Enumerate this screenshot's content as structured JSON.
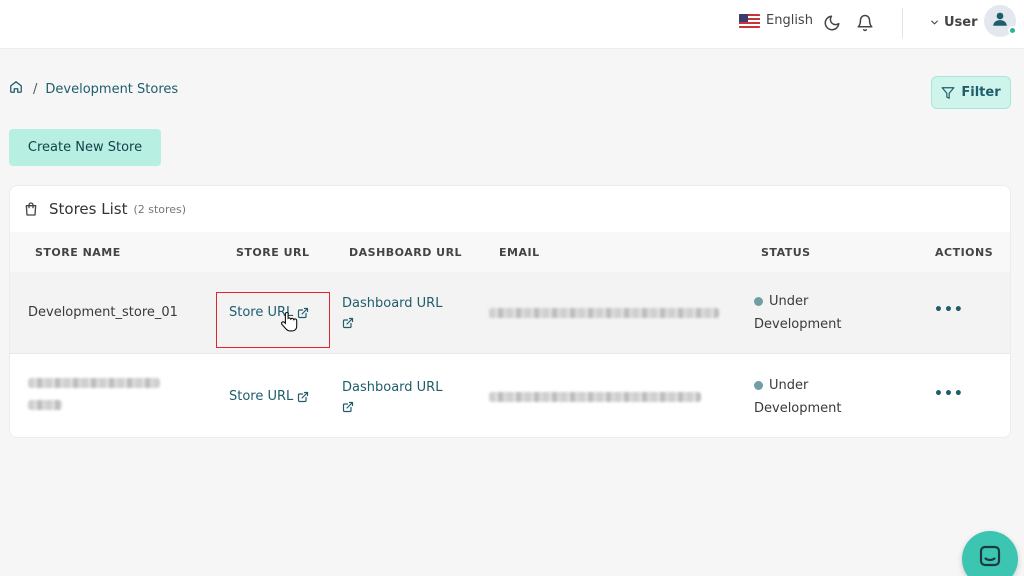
{
  "header": {
    "language": "English",
    "user_label": "User"
  },
  "breadcrumb": {
    "separator": "/",
    "current": "Development Stores"
  },
  "filter_label": "Filter",
  "create_label": "Create New Store",
  "stores_list": {
    "title": "Stores List",
    "count_label": "(2 stores)",
    "columns": [
      "STORE NAME",
      "STORE URL",
      "DASHBOARD URL",
      "EMAIL",
      "STATUS",
      "ACTIONS"
    ],
    "rows": [
      {
        "store_name": "Development_store_01",
        "store_url": "Store URL",
        "dashboard_url": "Dashboard URL",
        "status_line1": "Under",
        "status_line2": "Development",
        "actions": "•••"
      },
      {
        "store_name": "",
        "store_url": "Store URL",
        "dashboard_url": "Dashboard URL",
        "status_line1": "Under",
        "status_line2": "Development",
        "actions": "•••"
      }
    ]
  },
  "colors": {
    "accent": "#1f5d6b",
    "button_bg": "#b7efe2",
    "chat_bg": "#3cc6b2",
    "highlight": "#e0262c"
  },
  "icons": [
    "us-flag-icon",
    "moon-icon",
    "bell-icon",
    "chevron-down-icon",
    "user-icon",
    "home-icon",
    "filter-icon",
    "shopping-bag-icon",
    "external-link-icon",
    "cursor-hand-icon",
    "chat-icon"
  ]
}
